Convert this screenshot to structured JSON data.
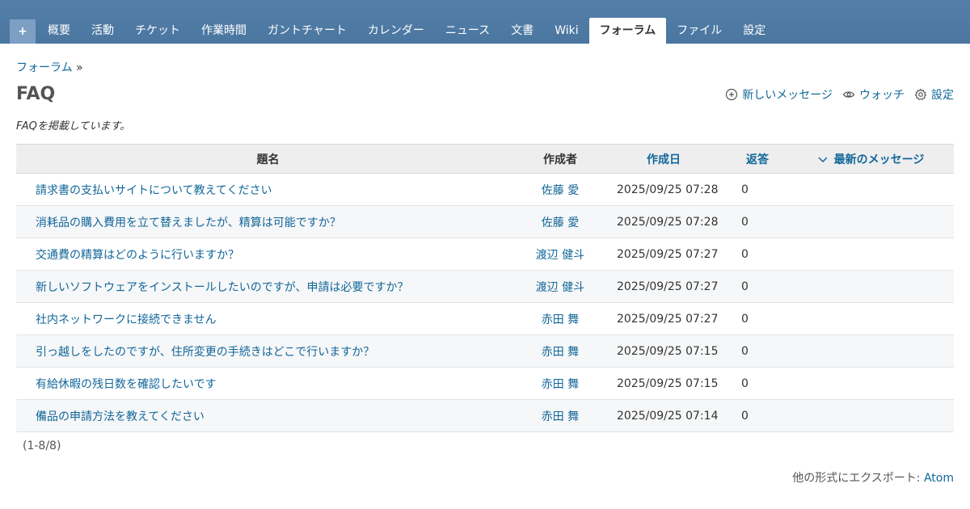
{
  "menu": {
    "new_label": "+",
    "tabs": [
      {
        "label": "概要"
      },
      {
        "label": "活動"
      },
      {
        "label": "チケット"
      },
      {
        "label": "作業時間"
      },
      {
        "label": "ガントチャート"
      },
      {
        "label": "カレンダー"
      },
      {
        "label": "ニュース"
      },
      {
        "label": "文書"
      },
      {
        "label": "Wiki"
      },
      {
        "label": "フォーラム",
        "selected": true
      },
      {
        "label": "ファイル"
      },
      {
        "label": "設定"
      }
    ]
  },
  "breadcrumb": {
    "link": "フォーラム",
    "sep": "»"
  },
  "board": {
    "title": "FAQ",
    "description": "FAQを掲載しています。"
  },
  "actions": {
    "new_message": "新しいメッセージ",
    "watch": "ウォッチ",
    "settings": "設定"
  },
  "table": {
    "headers": {
      "subject": "題名",
      "author": "作成者",
      "created": "作成日",
      "replies": "返答",
      "last_message": "最新のメッセージ"
    },
    "rows": [
      {
        "subject": "請求書の支払いサイトについて教えてください",
        "author": "佐藤 愛",
        "created": "2025/09/25 07:28",
        "replies": "0"
      },
      {
        "subject": "消耗品の購入費用を立て替えましたが、精算は可能ですか？",
        "author": "佐藤 愛",
        "created": "2025/09/25 07:28",
        "replies": "0"
      },
      {
        "subject": "交通費の精算はどのように行いますか？",
        "author": "渡辺 健斗",
        "created": "2025/09/25 07:27",
        "replies": "0"
      },
      {
        "subject": "新しいソフトウェアをインストールしたいのですが、申請は必要ですか？",
        "author": "渡辺 健斗",
        "created": "2025/09/25 07:27",
        "replies": "0"
      },
      {
        "subject": "社内ネットワークに接続できません",
        "author": "赤田 舞",
        "created": "2025/09/25 07:27",
        "replies": "0"
      },
      {
        "subject": "引っ越しをしたのですが、住所変更の手続きはどこで行いますか？",
        "author": "赤田 舞",
        "created": "2025/09/25 07:15",
        "replies": "0"
      },
      {
        "subject": "有給休暇の残日数を確認したいです",
        "author": "赤田 舞",
        "created": "2025/09/25 07:15",
        "replies": "0"
      },
      {
        "subject": "備品の申請方法を教えてください",
        "author": "赤田 舞",
        "created": "2025/09/25 07:14",
        "replies": "0"
      }
    ]
  },
  "pagination": "(1-8/8)",
  "export": {
    "label": "他の形式にエクスポート:",
    "format": "Atom"
  },
  "colors": {
    "header_bar": "#4a76a0",
    "link": "#116699",
    "row_alt": "#f6f7f8"
  }
}
